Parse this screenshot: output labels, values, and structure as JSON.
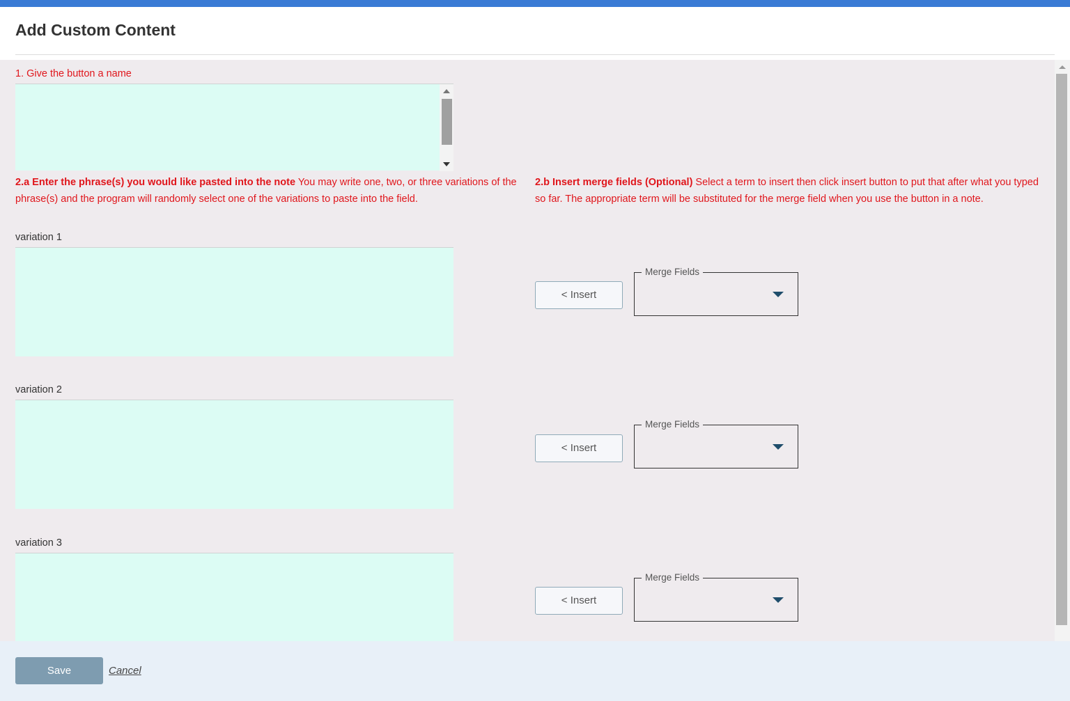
{
  "dialog": {
    "title": "Add Custom Content"
  },
  "section1": {
    "label": "1. Give the button a name",
    "value": ""
  },
  "section2a": {
    "heading": "2.a Enter the phrase(s) you would like pasted into the note",
    "text": " You may write one, two, or three variations of the phrase(s) and the program will randomly select one of the variations to paste into the field."
  },
  "section2b": {
    "heading": "2.b Insert merge fields (Optional)",
    "text": " Select a term to insert then click insert button to put that after what you typed so far. The appropriate term will be substituted for the merge field when you use the button in a note."
  },
  "variations": [
    {
      "label": "variation 1",
      "value": "",
      "insert_label": "< Insert",
      "merge_legend": "Merge Fields",
      "merge_value": ""
    },
    {
      "label": "variation 2",
      "value": "",
      "insert_label": "< Insert",
      "merge_legend": "Merge Fields",
      "merge_value": ""
    },
    {
      "label": "variation 3",
      "value": "",
      "insert_label": "< Insert",
      "merge_legend": "Merge Fields",
      "merge_value": ""
    }
  ],
  "footer": {
    "save_label": "Save",
    "cancel_label": "Cancel"
  },
  "colors": {
    "accent_bar": "#3a7bd5",
    "required_text": "#e0161c",
    "textarea_bg": "#dcfcf4",
    "content_bg": "#efebee",
    "save_button": "#7e9cb0"
  }
}
